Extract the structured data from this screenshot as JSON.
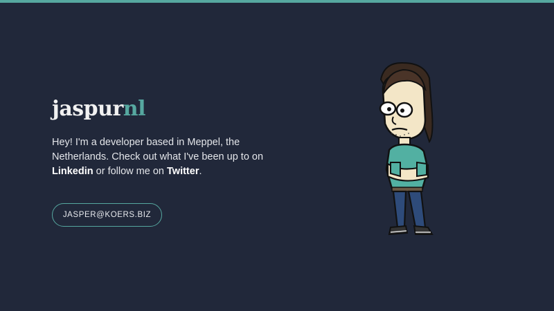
{
  "brand": {
    "part_a": "jaspur",
    "part_b": "nl"
  },
  "intro": {
    "line1": "Hey! I'm a developer based in Meppel, the Netherlands.",
    "line2_pre": "Check out what I've been up to on ",
    "linkedin_label": "Linkedin",
    "line2_mid": " or follow me on ",
    "twitter_label": "Twitter",
    "line2_end": "."
  },
  "contact": {
    "email_label": "JASPER@KOERS.BIZ"
  },
  "colors": {
    "background": "#21283a",
    "accent": "#56a8a0",
    "text": "#e4e6ea"
  },
  "icons": {
    "illustration": "cartoon-developer-illustration"
  }
}
